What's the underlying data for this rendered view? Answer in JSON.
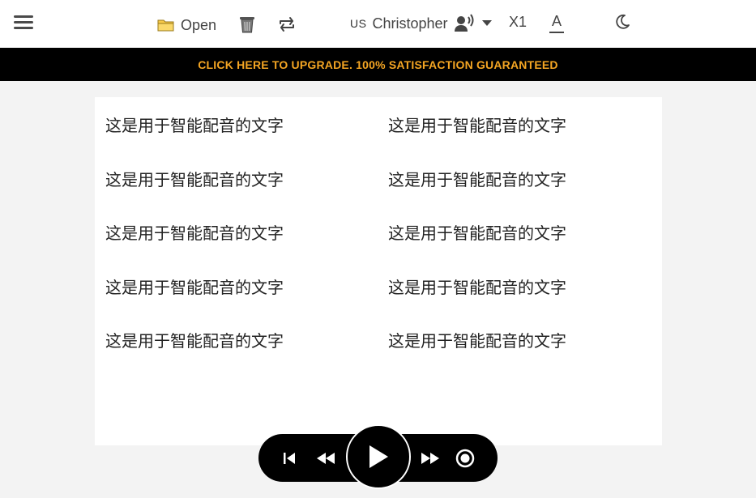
{
  "header": {
    "open_label": "Open",
    "voice": {
      "flag": "US",
      "name": "Christopher"
    },
    "speed_label": "X1",
    "font_label": "A"
  },
  "banner": {
    "text": "CLICK HERE TO UPGRADE. 100% SATISFACTION GUARANTEED"
  },
  "content": {
    "lines": [
      "这是用于智能配音的文字",
      "这是用于智能配音的文字",
      "这是用于智能配音的文字",
      "这是用于智能配音的文字",
      "这是用于智能配音的文字",
      "这是用于智能配音的文字",
      "这是用于智能配音的文字",
      "这是用于智能配音的文字",
      "这是用于智能配音的文字",
      "这是用于智能配音的文字"
    ]
  },
  "player": {
    "controls": [
      "skip-back",
      "rewind",
      "play",
      "fast-forward",
      "record"
    ]
  },
  "colors": {
    "banner_text": "#f5a623",
    "banner_bg": "#000000",
    "page_bg": "#f3f3f3"
  }
}
